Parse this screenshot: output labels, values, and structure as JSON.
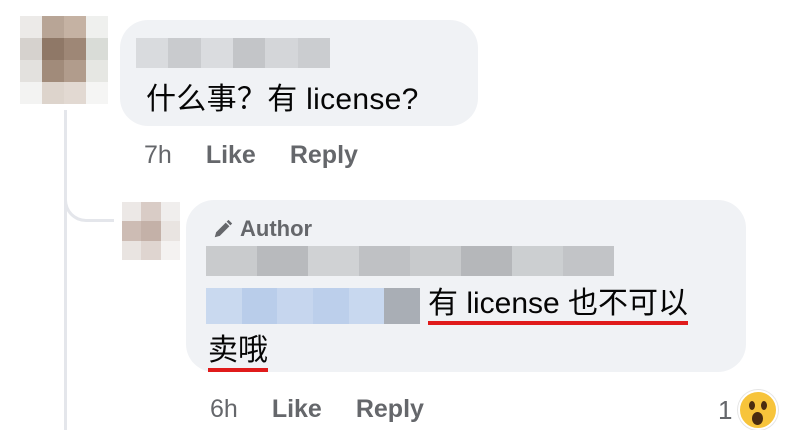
{
  "comment1": {
    "author": "",
    "text": "什么事？有 license?",
    "time": "7h",
    "like_label": "Like",
    "reply_label": "Reply"
  },
  "reply1": {
    "badge": "Author",
    "author": "",
    "text_line1": "有 license 也不可以",
    "text_line2": "卖哦",
    "time": "6h",
    "like_label": "Like",
    "reply_label": "Reply",
    "reaction_count": "1",
    "reaction_icon": "wow-emoji-icon"
  },
  "colors": {
    "bubble": "#f0f2f5",
    "secondary_text": "#65676b",
    "underline": "#e01b1b",
    "thread_line": "#e4e6eb"
  }
}
